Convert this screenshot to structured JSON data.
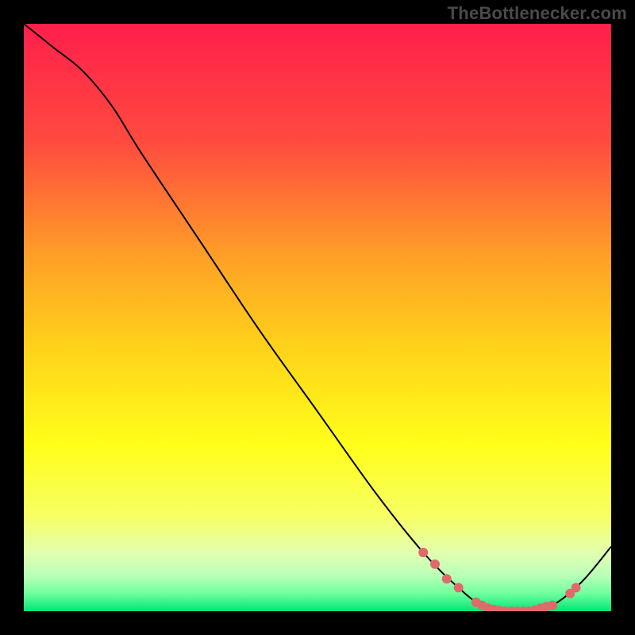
{
  "attribution": "TheBottlenecker.com",
  "chart_data": {
    "type": "line",
    "title": "",
    "xlabel": "",
    "ylabel": "",
    "xlim": [
      0,
      100
    ],
    "ylim": [
      0,
      100
    ],
    "curve": [
      {
        "x": 0,
        "y": 100
      },
      {
        "x": 5,
        "y": 96
      },
      {
        "x": 10,
        "y": 92
      },
      {
        "x": 15,
        "y": 86
      },
      {
        "x": 20,
        "y": 78
      },
      {
        "x": 30,
        "y": 63
      },
      {
        "x": 40,
        "y": 48
      },
      {
        "x": 50,
        "y": 34
      },
      {
        "x": 60,
        "y": 20
      },
      {
        "x": 68,
        "y": 10
      },
      {
        "x": 74,
        "y": 4
      },
      {
        "x": 78,
        "y": 1
      },
      {
        "x": 82,
        "y": 0
      },
      {
        "x": 86,
        "y": 0
      },
      {
        "x": 90,
        "y": 1
      },
      {
        "x": 95,
        "y": 5
      },
      {
        "x": 100,
        "y": 11
      }
    ],
    "highlight_points": [
      {
        "x": 68,
        "y": 10
      },
      {
        "x": 70,
        "y": 8
      },
      {
        "x": 72,
        "y": 5.5
      },
      {
        "x": 74,
        "y": 4
      },
      {
        "x": 77,
        "y": 1.5
      },
      {
        "x": 78,
        "y": 1
      },
      {
        "x": 79,
        "y": 0.5
      },
      {
        "x": 80,
        "y": 0.3
      },
      {
        "x": 81,
        "y": 0.1
      },
      {
        "x": 82,
        "y": 0
      },
      {
        "x": 83,
        "y": 0
      },
      {
        "x": 84,
        "y": 0
      },
      {
        "x": 85,
        "y": 0
      },
      {
        "x": 86,
        "y": 0
      },
      {
        "x": 87,
        "y": 0.2
      },
      {
        "x": 88,
        "y": 0.5
      },
      {
        "x": 89,
        "y": 0.8
      },
      {
        "x": 90,
        "y": 1
      },
      {
        "x": 93,
        "y": 3
      },
      {
        "x": 94,
        "y": 4
      }
    ],
    "optimal_band_y": [
      0,
      3
    ],
    "gradient_stops": [
      {
        "offset": 0.0,
        "color": "#ff1f4b"
      },
      {
        "offset": 0.2,
        "color": "#ff4a3f"
      },
      {
        "offset": 0.4,
        "color": "#ffa126"
      },
      {
        "offset": 0.55,
        "color": "#ffd21a"
      },
      {
        "offset": 0.72,
        "color": "#ffff1a"
      },
      {
        "offset": 0.84,
        "color": "#f7ff66"
      },
      {
        "offset": 0.9,
        "color": "#e3ffb0"
      },
      {
        "offset": 0.94,
        "color": "#b8ffb8"
      },
      {
        "offset": 0.97,
        "color": "#6fff9d"
      },
      {
        "offset": 1.0,
        "color": "#00e676"
      }
    ]
  },
  "colors": {
    "curve": "#000000",
    "dot_fill": "#e06a6a",
    "dot_stroke": "rgba(0,0,0,0)"
  }
}
